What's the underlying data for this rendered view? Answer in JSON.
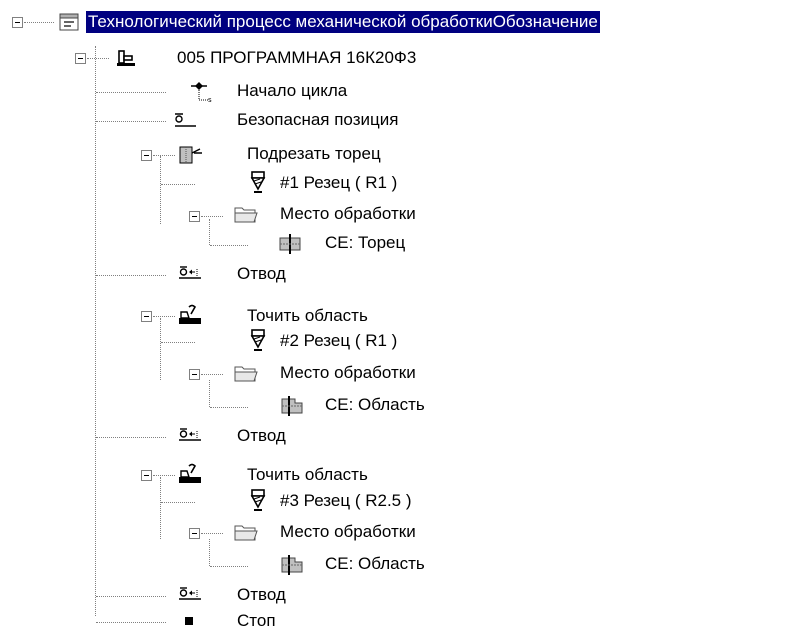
{
  "root": {
    "label": "Технологический процесс механической обработкиОбозначение"
  },
  "operation": {
    "label": "005 ПРОГРАММНАЯ 16К20Ф3"
  },
  "steps": {
    "cycle_start": "Начало цикла",
    "safe_position": "Безопасная позиция",
    "face_trim": {
      "label": "Подрезать торец",
      "tool": "#1 Резец ( R1 )",
      "place": "Место обработки",
      "element": "СЕ: Торец"
    },
    "retract_1": "Отвод",
    "turn_area_1": {
      "label": "Точить область",
      "tool": "#2 Резец ( R1 )",
      "place": "Место обработки",
      "element": "СЕ: Область"
    },
    "retract_2": "Отвод",
    "turn_area_2": {
      "label": "Точить область",
      "tool": "#3 Резец ( R2.5 )",
      "place": "Место обработки",
      "element": "СЕ: Область"
    },
    "retract_3": "Отвод",
    "stop": "Стоп"
  }
}
